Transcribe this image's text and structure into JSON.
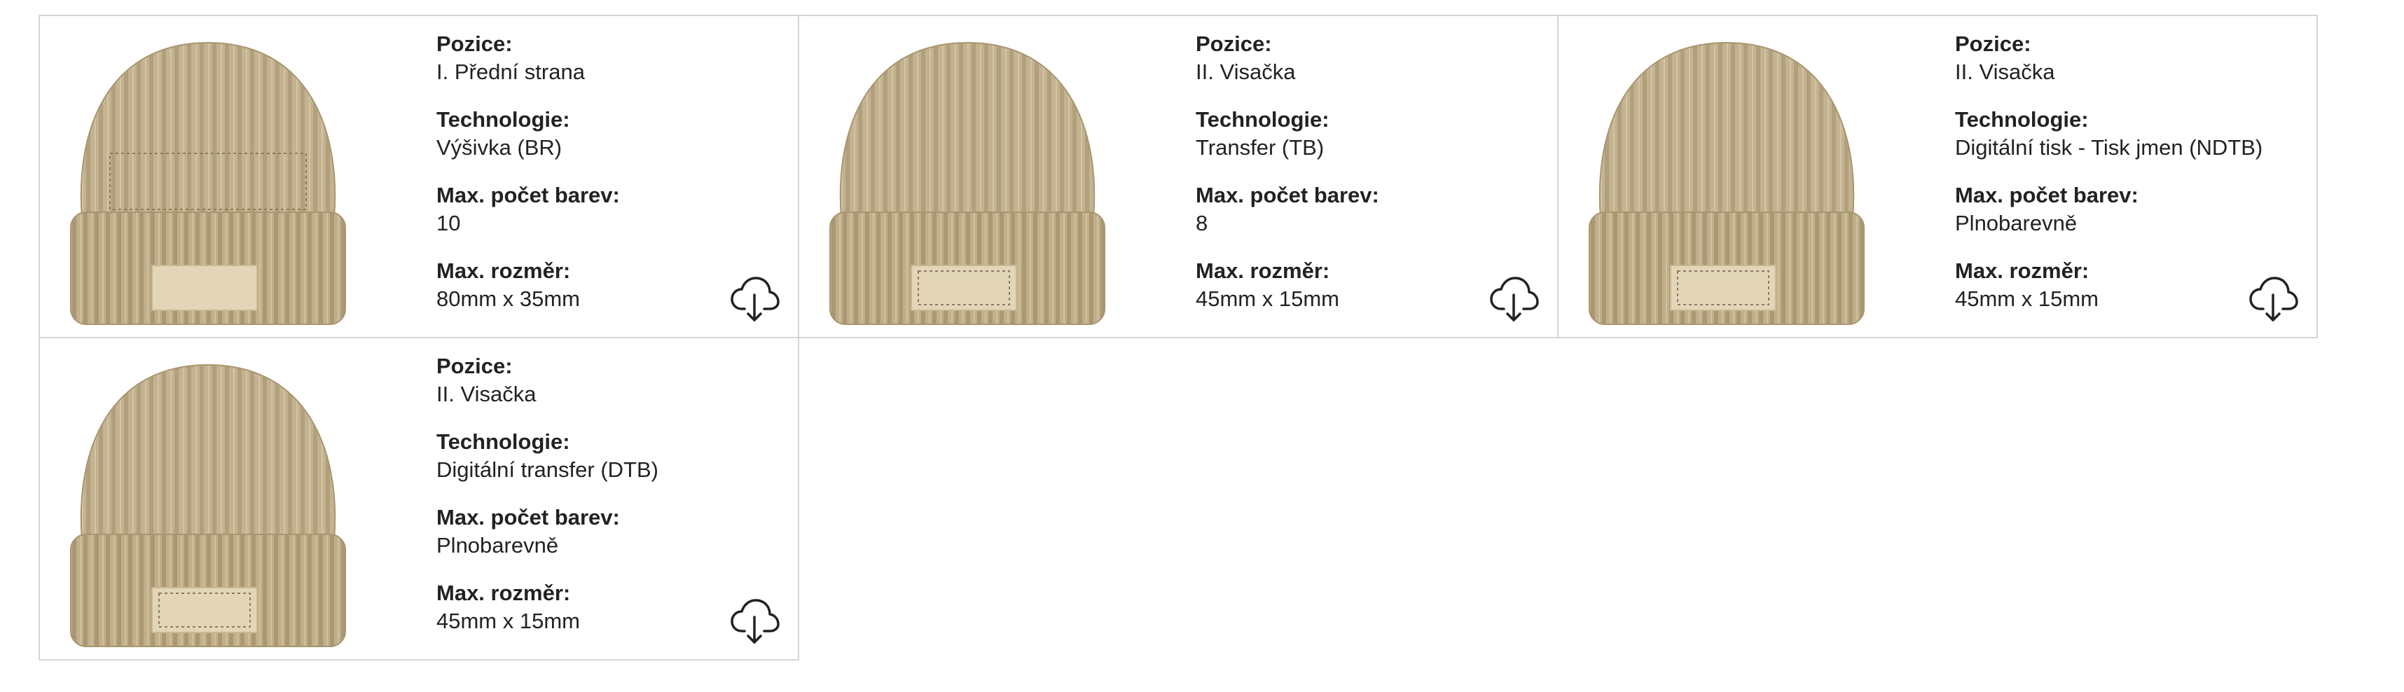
{
  "labels": {
    "position": "Pozice:",
    "technology": "Technologie:",
    "max_colors": "Max. počet barev:",
    "max_size": "Max. rozměr:"
  },
  "cards": [
    {
      "position": "I. Přední strana",
      "technology": "Výšivka (BR)",
      "max_colors": "10",
      "max_size": "80mm x 35mm",
      "print_area": "front",
      "download_icon": "cloud-download-icon"
    },
    {
      "position": "II. Visačka",
      "technology": "Transfer (TB)",
      "max_colors": "8",
      "max_size": "45mm x 15mm",
      "print_area": "label",
      "download_icon": "cloud-download-icon"
    },
    {
      "position": "II. Visačka",
      "technology": "Digitální tisk - Tisk jmen (NDTB)",
      "max_colors": "Plnobarevně",
      "max_size": "45mm x 15mm",
      "print_area": "label",
      "download_icon": "cloud-download-icon"
    },
    {
      "position": "II. Visačka",
      "technology": "Digitální transfer (DTB)",
      "max_colors": "Plnobarevně",
      "max_size": "45mm x 15mm",
      "print_area": "label",
      "download_icon": "cloud-download-icon"
    }
  ],
  "colors": {
    "beanie": "#c6b594",
    "beanie_dark": "#a8966f",
    "patch": "#e3d6b8",
    "border": "#d6d6d6",
    "text": "#222222"
  }
}
